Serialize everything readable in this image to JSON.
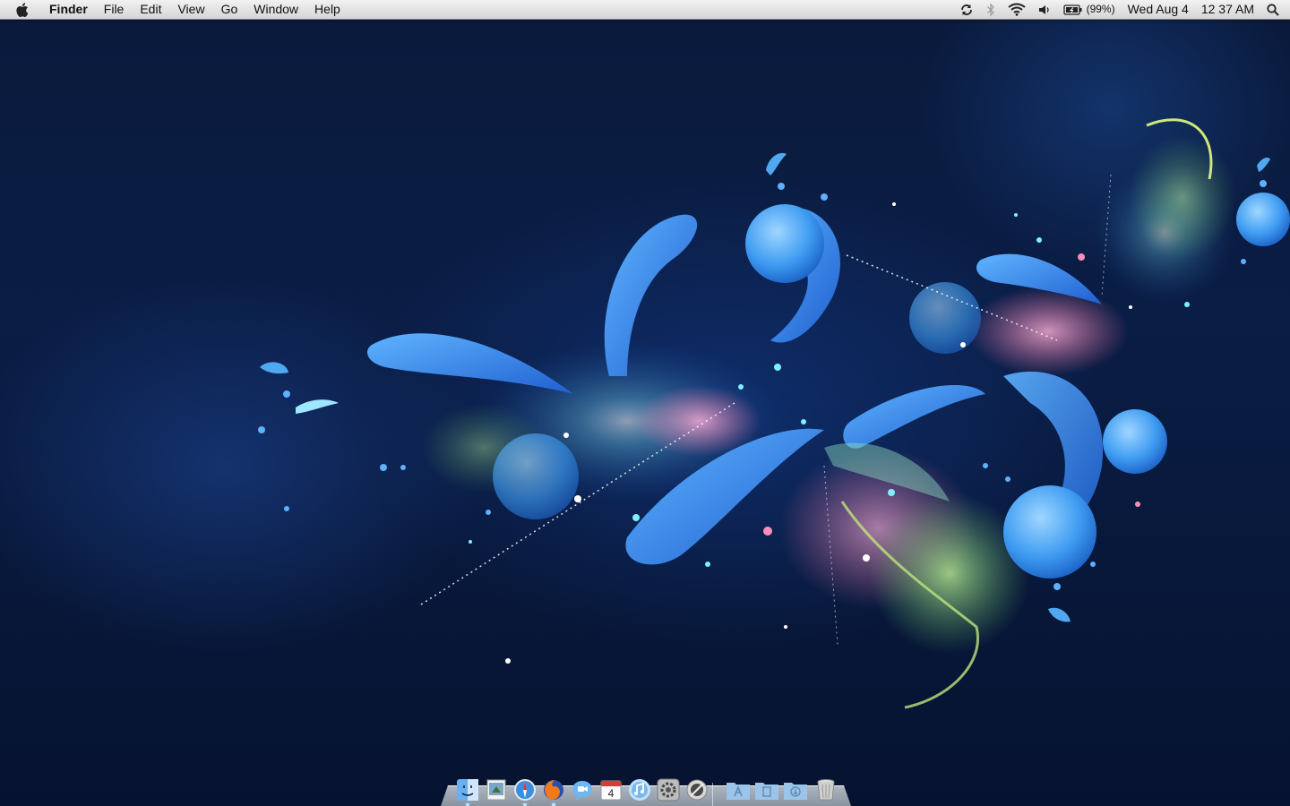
{
  "menubar": {
    "app_name": "Finder",
    "menus": [
      "File",
      "Edit",
      "View",
      "Go",
      "Window",
      "Help"
    ],
    "status": {
      "sync_icon": "sync-icon",
      "bluetooth_icon": "bluetooth-icon",
      "wifi_icon": "wifi-icon",
      "volume_icon": "volume-icon",
      "battery_percent": "(99%)",
      "date": "Wed Aug 4",
      "time": "12 37 AM",
      "spotlight_icon": "spotlight-icon"
    }
  },
  "dock": {
    "apps": [
      {
        "name": "Finder",
        "icon": "finder-icon"
      },
      {
        "name": "Preview",
        "icon": "preview-icon"
      },
      {
        "name": "Safari",
        "icon": "safari-icon"
      },
      {
        "name": "Firefox",
        "icon": "firefox-icon"
      },
      {
        "name": "iChat",
        "icon": "ichat-icon"
      },
      {
        "name": "iCal",
        "icon": "ical-icon",
        "badge": "4"
      },
      {
        "name": "iTunes",
        "icon": "itunes-icon"
      },
      {
        "name": "System Preferences",
        "icon": "system-preferences-icon"
      },
      {
        "name": "Terminal Tool",
        "icon": "utility-icon"
      }
    ],
    "stacks": [
      {
        "name": "Applications",
        "icon": "applications-folder-icon"
      },
      {
        "name": "Documents",
        "icon": "documents-folder-icon"
      },
      {
        "name": "Downloads",
        "icon": "downloads-folder-icon"
      },
      {
        "name": "Trash",
        "icon": "trash-icon"
      }
    ]
  },
  "colors": {
    "wallpaper_base": "#0a1d45",
    "accent_blue": "#3f9cf2",
    "menubar": "#e3e3e3"
  }
}
